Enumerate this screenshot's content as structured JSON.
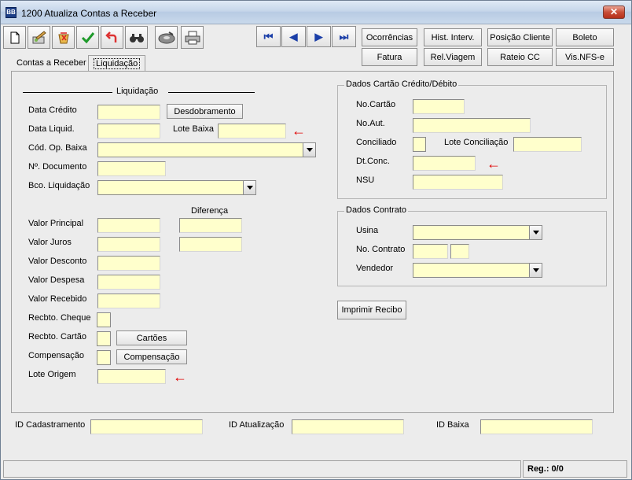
{
  "window": {
    "icon_text": "BB",
    "title": "1200 Atualiza Contas a Receber",
    "close_glyph": "✕"
  },
  "toolbar": {
    "icons": [
      "new-document-icon",
      "edit-icon",
      "delete-icon",
      "confirm-icon",
      "undo-icon",
      "search-icon",
      "disk-icon",
      "print-icon"
    ],
    "nav": {
      "first": "⏮",
      "prev": "◀",
      "next": "▶",
      "last": "⏭"
    },
    "buttons": {
      "ocorrencias": "Ocorrências",
      "hist_interv": "Hist. Interv.",
      "posicao_cliente": "Posição Cliente",
      "boleto": "Boleto",
      "fatura": "Fatura",
      "rel_viagem": "Rel.Viagem",
      "rateio_cc": "Rateio CC",
      "vis_nfse": "Vis.NFS-e"
    }
  },
  "tabs": [
    {
      "label": "Contas a Receber",
      "active": false
    },
    {
      "label": "Liquidação",
      "active": true
    }
  ],
  "liquidacao": {
    "section_title": "Liquidação",
    "data_credito": "Data Crédito",
    "desdobramento_btn": "Desdobramento",
    "data_liquid": "Data Liquid.",
    "lote_baixa": "Lote Baixa",
    "cod_op_baixa": "Cód. Op. Baixa",
    "n_documento": "Nº. Documento",
    "bco_liquidacao": "Bco. Liquidação",
    "diferenca": "Diferença",
    "valor_principal": "Valor Principal",
    "valor_juros": "Valor Juros",
    "valor_desconto": "Valor Desconto",
    "valor_despesa": "Valor Despesa",
    "valor_recebido": "Valor Recebido",
    "recbto_cheque": "Recbto. Cheque",
    "recbto_cartao": "Recbto. Cartão",
    "cartoes_btn": "Cartões",
    "compensacao": "Compensação",
    "compensacao_btn": "Compensação",
    "lote_origem": "Lote Origem"
  },
  "cartao": {
    "title": "Dados Cartão Crédito/Débito",
    "no_cartao": "No.Cartão",
    "no_aut": "No.Aut.",
    "conciliado": "Conciliado",
    "lote_conciliacao": "Lote Conciliação",
    "dt_conc": "Dt.Conc.",
    "nsu": "NSU"
  },
  "contrato": {
    "title": "Dados Contrato",
    "usina": "Usina",
    "no_contrato": "No. Contrato",
    "vendedor": "Vendedor"
  },
  "imprimir_recibo": "Imprimir Recibo",
  "bottom": {
    "id_cadastramento": "ID Cadastramento",
    "id_atualizacao": "ID Atualização",
    "id_baixa": "ID Baixa"
  },
  "status": {
    "reg": "Reg.: 0/0"
  },
  "colors": {
    "field_bg": "#ffffcc",
    "marker": "#e00000"
  }
}
